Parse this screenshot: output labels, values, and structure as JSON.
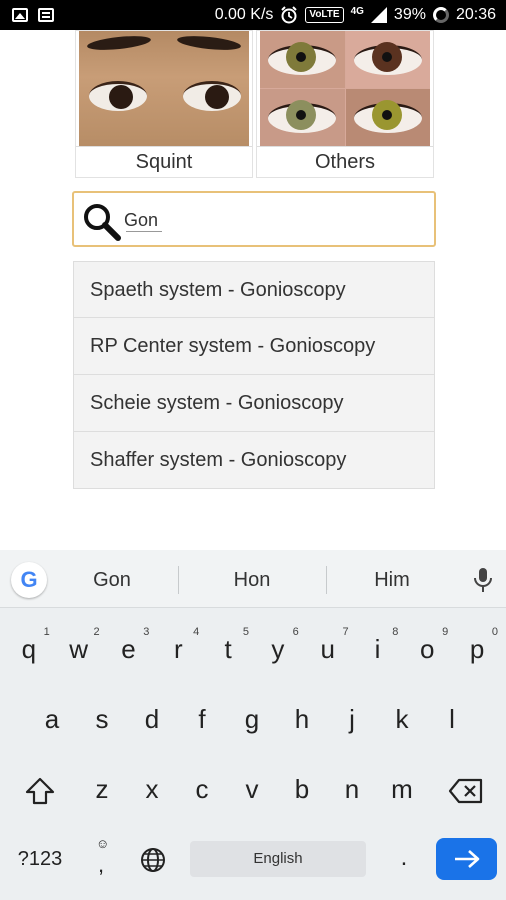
{
  "status_bar": {
    "network_speed": "0.00 K/s",
    "volte_label": "VoLTE",
    "network_type": "4G",
    "battery": "39%",
    "time": "20:36"
  },
  "categories": [
    {
      "label": "Squint",
      "icon": "squint-eyes-photo"
    },
    {
      "label": "Others",
      "icon": "colored-eyes-collage-photo"
    }
  ],
  "search": {
    "value": "Gon",
    "placeholder": ""
  },
  "results": [
    "Spaeth system - Gonioscopy",
    "RP Center system - Gonioscopy",
    "Scheie system - Gonioscopy",
    "Shaffer system - Gonioscopy"
  ],
  "keyboard": {
    "suggestions": [
      "Gon",
      "Hon",
      "Him"
    ],
    "row1": [
      {
        "key": "q",
        "hint": "1"
      },
      {
        "key": "w",
        "hint": "2"
      },
      {
        "key": "e",
        "hint": "3"
      },
      {
        "key": "r",
        "hint": "4"
      },
      {
        "key": "t",
        "hint": "5"
      },
      {
        "key": "y",
        "hint": "6"
      },
      {
        "key": "u",
        "hint": "7"
      },
      {
        "key": "i",
        "hint": "8"
      },
      {
        "key": "o",
        "hint": "9"
      },
      {
        "key": "p",
        "hint": "0"
      }
    ],
    "row2": [
      "a",
      "s",
      "d",
      "f",
      "g",
      "h",
      "j",
      "k",
      "l"
    ],
    "row3": [
      "z",
      "x",
      "c",
      "v",
      "b",
      "n",
      "m"
    ],
    "symbols_label": "?123",
    "comma_label": ",",
    "space_label": "English",
    "period_label": ".",
    "colors": {
      "enter": "#1a73e8",
      "google_blue": "#4285f4"
    }
  }
}
